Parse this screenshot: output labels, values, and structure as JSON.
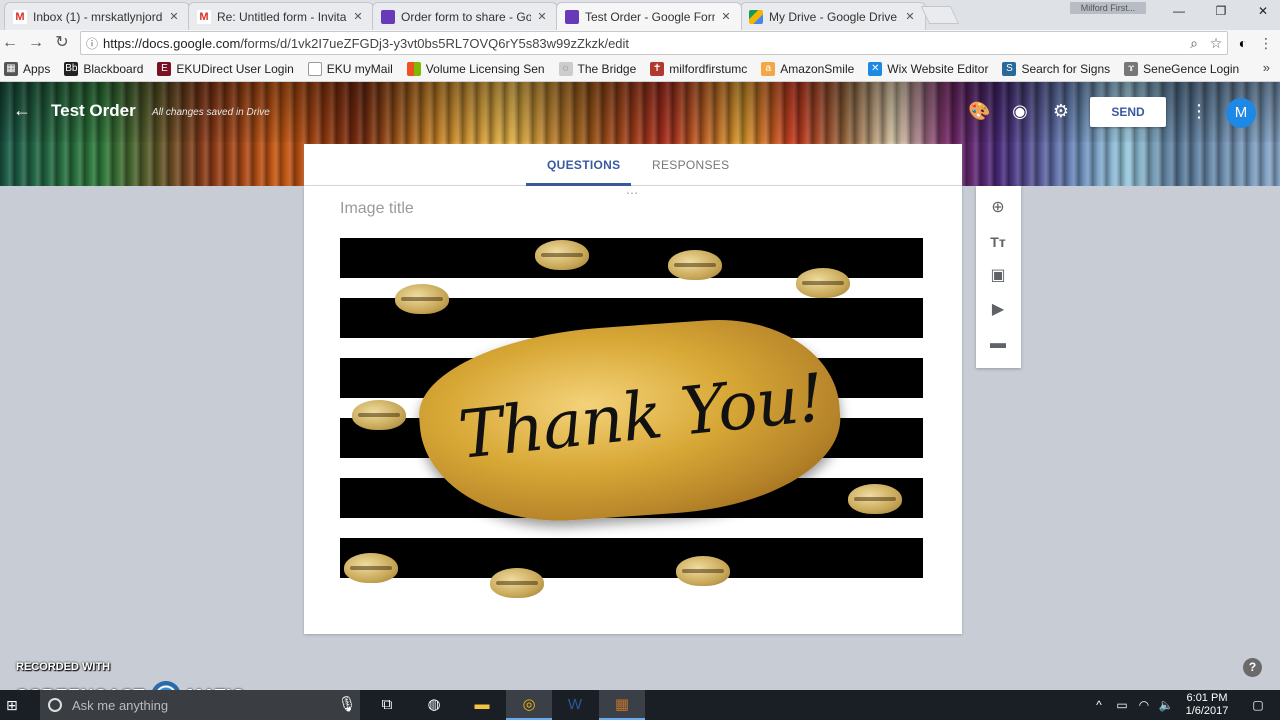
{
  "browser": {
    "tabs": [
      {
        "label": "Inbox (1) - mrskatlynjord",
        "icon": "gmail-icon",
        "color": "#d93025"
      },
      {
        "label": "Re: Untitled form - Invita",
        "icon": "gmail-icon",
        "color": "#d93025"
      },
      {
        "label": "Order form to share - Go",
        "icon": "forms-icon",
        "color": "#673ab7"
      },
      {
        "label": "Test Order - Google Form",
        "icon": "forms-icon",
        "color": "#673ab7",
        "active": true
      },
      {
        "label": "My Drive - Google Drive",
        "icon": "drive-icon",
        "color": "#f4b400"
      }
    ],
    "profile_label": "Milford First...",
    "url_host": "https://docs.google.com",
    "url_path": "/forms/d/1vk2I7ueZFGDj3-y3vt0bs5RL7OVQ6rY5s83w99zZkzk/edit",
    "bookmarks": [
      {
        "label": "Apps",
        "icon": "apps-icon",
        "color": "#555"
      },
      {
        "label": "Blackboard",
        "icon": "blackboard-icon",
        "color": "#222"
      },
      {
        "label": "EKUDirect User Login",
        "icon": "eku-icon",
        "color": "#7a1020"
      },
      {
        "label": "EKU myMail",
        "icon": "page-icon",
        "color": "#999"
      },
      {
        "label": "Volume Licensing Sen",
        "icon": "windows-icon",
        "color": "#f25022"
      },
      {
        "label": "The Bridge",
        "icon": "bridge-icon",
        "color": "#aaa"
      },
      {
        "label": "milfordfirstumc",
        "icon": "church-icon",
        "color": "#b03a2e"
      },
      {
        "label": "AmazonSmile",
        "icon": "amazon-icon",
        "color": "#f3a847"
      },
      {
        "label": "Wix Website Editor",
        "icon": "wix-icon",
        "color": "#1e88e5"
      },
      {
        "label": "Search for Signs",
        "icon": "signs-icon",
        "color": "#2a6a9a"
      },
      {
        "label": "SeneGence Login",
        "icon": "senegence-icon",
        "color": "#555"
      }
    ]
  },
  "form_header": {
    "title": "Test Order",
    "saved_status": "All changes saved in Drive",
    "send_label": "SEND",
    "avatar_letter": "M"
  },
  "form_tabs": {
    "questions": "QUESTIONS",
    "responses": "RESPONSES"
  },
  "image_item": {
    "title_placeholder": "Image title",
    "image_text": "Thank You!"
  },
  "side_tools": [
    {
      "name": "add-question-icon",
      "glyph": "⊕"
    },
    {
      "name": "add-title-icon",
      "glyph": "Tт"
    },
    {
      "name": "add-image-icon",
      "glyph": "▣"
    },
    {
      "name": "add-video-icon",
      "glyph": "▶"
    },
    {
      "name": "add-section-icon",
      "glyph": "▬"
    }
  ],
  "watermark": {
    "recorded_with": "RECORDED WITH",
    "brand_left": "SCREENCAST",
    "brand_right": "MATIC"
  },
  "taskbar": {
    "search_placeholder": "Ask me anything",
    "time": "6:01 PM",
    "date": "1/6/2017"
  },
  "colors": {
    "accent": "#3a5aa0",
    "avatar": "#1e88e5",
    "background": "#c8ccd4"
  }
}
